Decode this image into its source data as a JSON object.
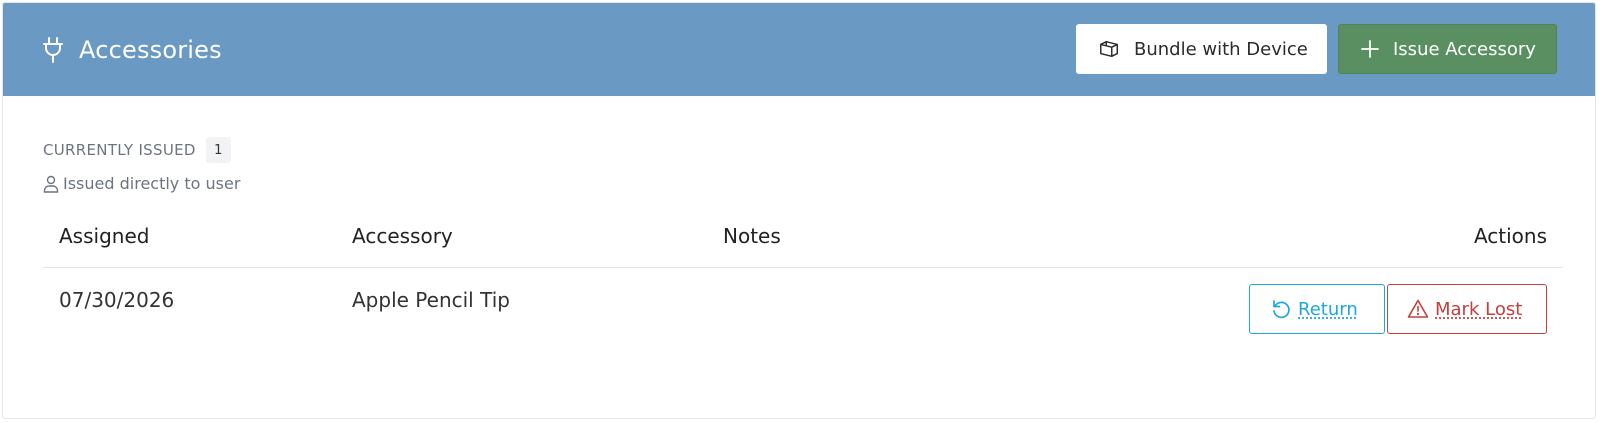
{
  "header": {
    "icon": "plug-icon",
    "title": "Accessories",
    "bundle_button": {
      "label": "Bundle with Device",
      "icon": "box-icon"
    },
    "issue_button": {
      "label": "Issue Accessory",
      "icon": "plus-icon"
    }
  },
  "summary": {
    "currently_issued_label": "CURRENTLY ISSUED",
    "currently_issued_count": "1",
    "issued_directly_label": "Issued directly to user",
    "issued_directly_icon": "user-icon"
  },
  "table": {
    "columns": [
      "Assigned",
      "Accessory",
      "Notes",
      "Actions"
    ],
    "rows": [
      {
        "assigned": "07/30/2026",
        "accessory": "Apple Pencil Tip",
        "notes": "",
        "actions": {
          "return_label": "Return",
          "return_icon": "undo-icon",
          "lost_label": "Mark Lost",
          "lost_icon": "warning-icon"
        }
      }
    ]
  },
  "colors": {
    "header_bg": "#6a99c3",
    "issue_button_bg": "#5a9061",
    "return_color": "#1ea8d8",
    "lost_color": "#c0403c"
  }
}
